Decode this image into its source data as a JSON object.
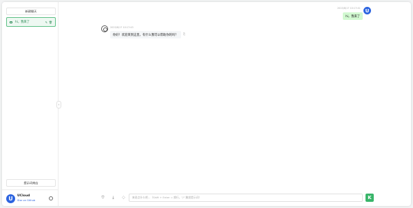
{
  "sidebar": {
    "new_chat_label": "新建聊天",
    "sessions": [
      {
        "title": "hi，我来了",
        "edit_icon": "edit-icon",
        "delete_icon": "trash-icon"
      }
    ],
    "prompt_store_label": "提示词商店"
  },
  "user": {
    "avatar_letter": "U",
    "name": "UCloud",
    "link": "Star on Github"
  },
  "chat": {
    "messages": [
      {
        "role": "user",
        "time": "2023/8/17 10:17:41",
        "text": "hi，我来了",
        "avatar_letter": "U"
      },
      {
        "role": "assistant",
        "time": "2023/8/17 10:17:43",
        "text": "你好！欢迎来到这里，有什么我可以帮助你的吗？"
      }
    ]
  },
  "composer": {
    "placeholder": "来说点什么吧...（Shift + Enter = 换行，\"/\" 触发提示词）",
    "send_letter": "K"
  },
  "colors": {
    "accent": "#39b56a",
    "user_bubble": "#d2f9d1",
    "avatar": "#2c64e0"
  }
}
